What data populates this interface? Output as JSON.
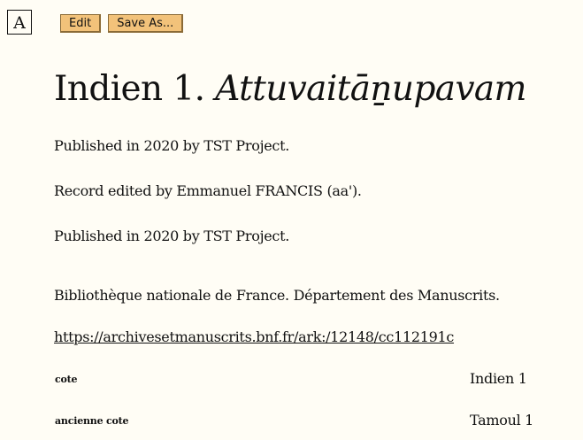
{
  "font_toggle": {
    "label": "A"
  },
  "toolbar": {
    "edit_label": "Edit",
    "save_as_label": "Save As..."
  },
  "title": {
    "prefix": "Indien 1.",
    "italic": "Attuvaitāṉupavam"
  },
  "published_1": "Published in 2020 by TST Project.",
  "edited_by": "Record edited by Emmanuel FRANCIS (aa').",
  "published_2": "Published in 2020 by TST Project.",
  "repository": "Bibliothèque nationale de France. Département des Manuscrits.",
  "link": {
    "text": "https://archivesetmanuscrits.bnf.fr/ark:/12148/cc112191c",
    "href": "https://archivesetmanuscrits.bnf.fr/ark:/12148/cc112191c"
  },
  "fields": [
    {
      "label": "cote",
      "value": "Indien 1"
    },
    {
      "label": "ancienne cote",
      "value": "Tamoul 1"
    }
  ],
  "colors": {
    "background": "#fffdf5",
    "button": "#f2c27a"
  }
}
